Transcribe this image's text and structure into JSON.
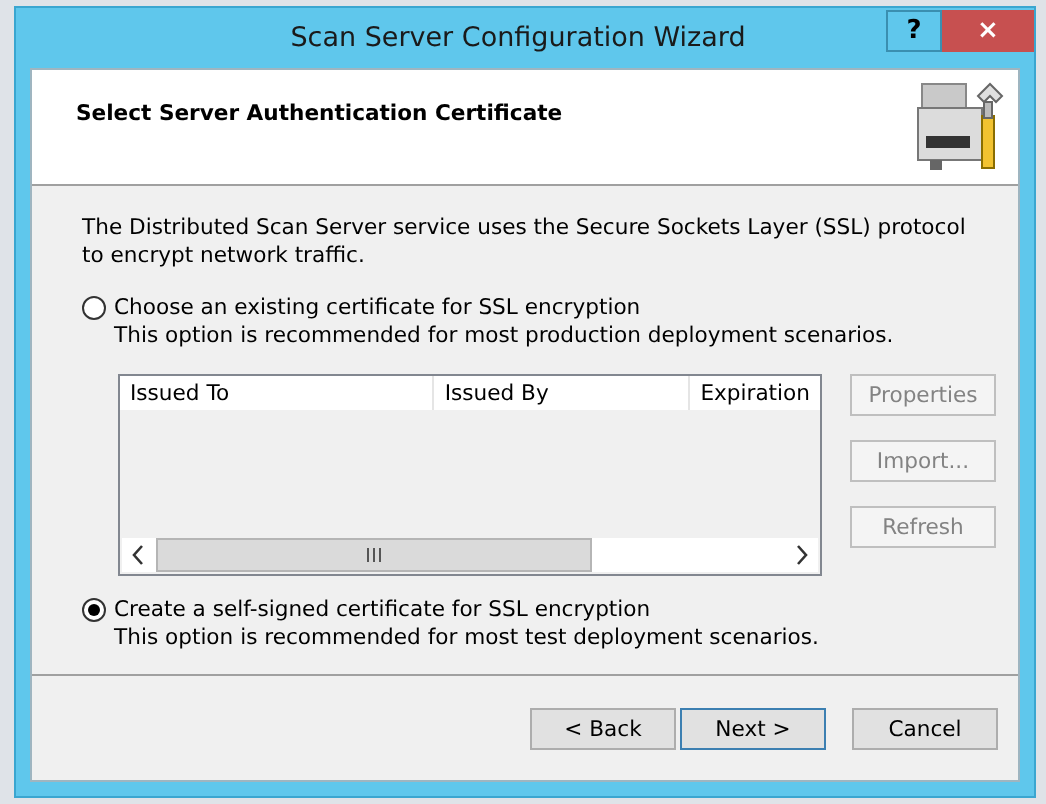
{
  "window": {
    "title": "Scan Server Configuration Wizard",
    "help_button": "?",
    "close_button": "×"
  },
  "header": {
    "title": "Select Server Authentication Certificate"
  },
  "intro": "The Distributed Scan Server service uses the Secure Sockets Layer (SSL) protocol to encrypt network traffic.",
  "options": [
    {
      "label": "Choose an existing certificate for SSL encryption",
      "description": "This option is recommended for most production deployment scenarios.",
      "selected": false
    },
    {
      "label": "Create a self-signed certificate for SSL encryption",
      "description": "This option is recommended for most test deployment scenarios.",
      "selected": true
    }
  ],
  "certificate_table": {
    "columns": [
      "Issued To",
      "Issued By",
      "Expiration"
    ]
  },
  "side_buttons": [
    {
      "label": "Properties",
      "disabled": true
    },
    {
      "label": "Import...",
      "disabled": true
    },
    {
      "label": "Refresh",
      "disabled": true
    }
  ],
  "footer_buttons": [
    {
      "label": "< Back",
      "default": false
    },
    {
      "label": "Next >",
      "default": true
    },
    {
      "label": "Cancel",
      "default": false
    }
  ]
}
